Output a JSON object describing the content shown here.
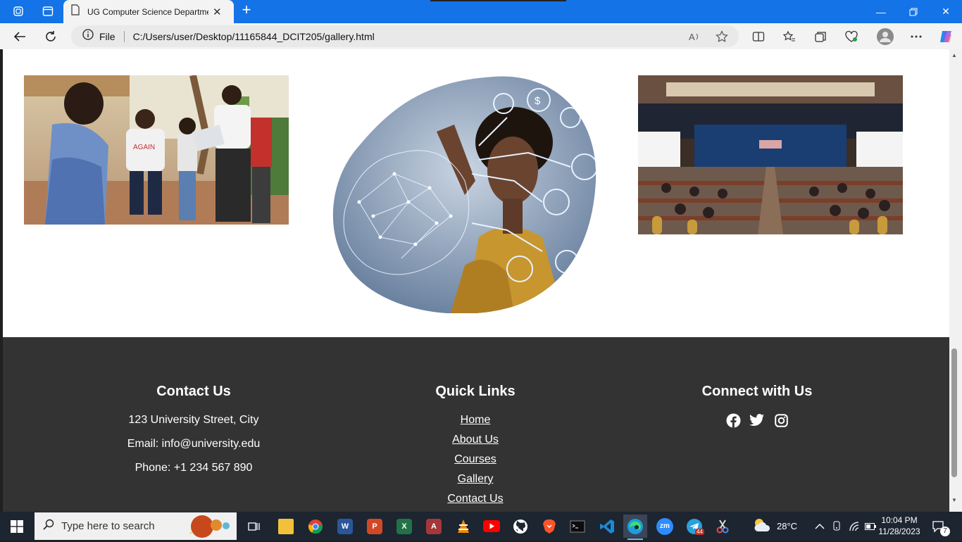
{
  "browser": {
    "tab_title": "UG Computer Science Departme",
    "address_prefix": "File",
    "url": "C:/Users/user/Desktop/11165844_DCIT205/gallery.html"
  },
  "gallery": {
    "images": [
      {
        "alt": "Students chatting outdoors"
      },
      {
        "alt": "Woman touching digital brain network"
      },
      {
        "alt": "Conference hall audience"
      }
    ]
  },
  "footer": {
    "contact": {
      "heading": "Contact Us",
      "address": "123 University Street, City",
      "email": "Email: info@university.edu",
      "phone": "Phone: +1 234 567 890"
    },
    "quick_links": {
      "heading": "Quick Links",
      "links": [
        "Home",
        "About Us",
        "Courses",
        "Gallery",
        "Contact Us"
      ]
    },
    "connect": {
      "heading": "Connect with Us",
      "icons": [
        "facebook-icon",
        "twitter-icon",
        "instagram-icon"
      ]
    }
  },
  "taskbar": {
    "search_placeholder": "Type here to search",
    "weather": "28°C",
    "time": "10:04 PM",
    "date": "11/28/2023",
    "notification_count": "7",
    "telegram_badge": "44"
  }
}
